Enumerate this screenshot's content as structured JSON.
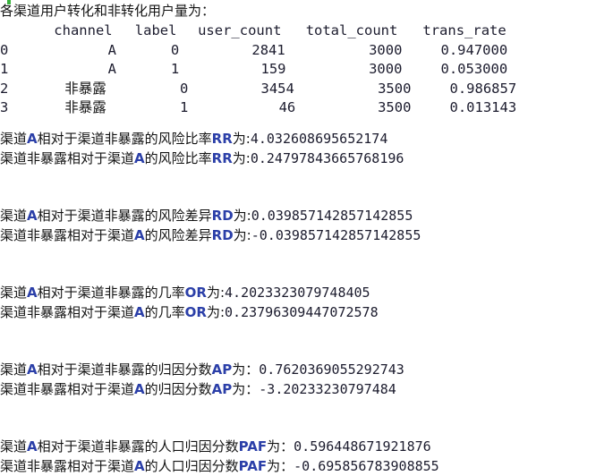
{
  "console": {
    "background": "#ffffff",
    "text_color": "#141414",
    "accent_color": "#2b3fa8",
    "number_color": "#1c1c2e"
  },
  "title": "各渠道用户转化和非转化用户量为：",
  "table": {
    "index_header": "",
    "columns": [
      "channel",
      "label",
      "user_count",
      "total_count",
      "trans_rate"
    ],
    "rows": [
      {
        "index": "0",
        "channel": "A",
        "label": "0",
        "user_count": "2841",
        "total_count": "3000",
        "trans_rate": "0.947000"
      },
      {
        "index": "1",
        "channel": "A",
        "label": "1",
        "user_count": "159",
        "total_count": "3000",
        "trans_rate": "0.053000"
      },
      {
        "index": "2",
        "channel": "非暴露",
        "label": "0",
        "user_count": "3454",
        "total_count": "3500",
        "trans_rate": "0.986857"
      },
      {
        "index": "3",
        "channel": "非暴露",
        "label": "1",
        "user_count": "46",
        "total_count": "3500",
        "trans_rate": "0.013143"
      }
    ],
    "header_text": "   channel  label  user_count  total_count  trans_rate",
    "row_text": [
      "0        A      0        2841         3000    0.947000",
      "1        A      1         159         3000    0.053000",
      "2     非暴露      0        3454         3500    0.986857",
      "3     非暴露      1          46         3500    0.013143"
    ]
  },
  "metrics": [
    {
      "id": "rr",
      "acronym": "RR",
      "lines": [
        {
          "prefix_zh": "渠道",
          "a1": "A",
          "mid_zh": "相对于渠道非暴露的风险比率",
          "acr": "RR",
          "suffix_zh": "为",
          "colon": ":",
          "value": "4.032608695652174"
        },
        {
          "prefix_zh": "渠道非暴露相对于渠道",
          "a1": "A",
          "mid_zh": "的风险比率",
          "acr": "RR",
          "suffix_zh": "为",
          "colon": ":",
          "value": "0.24797843665768196"
        }
      ]
    },
    {
      "id": "rd",
      "acronym": "RD",
      "lines": [
        {
          "prefix_zh": "渠道",
          "a1": "A",
          "mid_zh": "相对于渠道非暴露的风险差异",
          "acr": "RD",
          "suffix_zh": "为",
          "colon": ":",
          "value": "0.039857142857142855"
        },
        {
          "prefix_zh": "渠道非暴露相对于渠道",
          "a1": "A",
          "mid_zh": "的风险差异",
          "acr": "RD",
          "suffix_zh": "为",
          "colon": ":",
          "value": "-0.039857142857142855"
        }
      ]
    },
    {
      "id": "or",
      "acronym": "OR",
      "lines": [
        {
          "prefix_zh": "渠道",
          "a1": "A",
          "mid_zh": "相对于渠道非暴露的几率",
          "acr": "OR",
          "suffix_zh": "为",
          "colon": ":",
          "value": "4.2023323079748405"
        },
        {
          "prefix_zh": "渠道非暴露相对于渠道",
          "a1": "A",
          "mid_zh": "的几率",
          "acr": "OR",
          "suffix_zh": "为",
          "colon": ":",
          "value": "0.23796309447072578"
        }
      ]
    },
    {
      "id": "ap",
      "acronym": "AP",
      "lines": [
        {
          "prefix_zh": "渠道",
          "a1": "A",
          "mid_zh": "相对于渠道非暴露的归因分数",
          "acr": "AP",
          "suffix_zh": "为",
          "colon": "：",
          "value": "0.7620369055292743"
        },
        {
          "prefix_zh": "渠道非暴露相对于渠道",
          "a1": "A",
          "mid_zh": "的归因分数",
          "acr": "AP",
          "suffix_zh": "为",
          "colon": "：",
          "value": "-3.20233230797484"
        }
      ]
    },
    {
      "id": "paf",
      "acronym": "PAF",
      "lines": [
        {
          "prefix_zh": "渠道",
          "a1": "A",
          "mid_zh": "相对于渠道非暴露的人口归因分数",
          "acr": "PAF",
          "suffix_zh": "为",
          "colon": "：",
          "value": "0.596448671921876"
        },
        {
          "prefix_zh": "渠道非暴露相对于渠道",
          "a1": "A",
          "mid_zh": "的人口归因分数",
          "acr": "PAF",
          "suffix_zh": "为",
          "colon": "：",
          "value": "-0.695856783908855"
        }
      ]
    }
  ]
}
